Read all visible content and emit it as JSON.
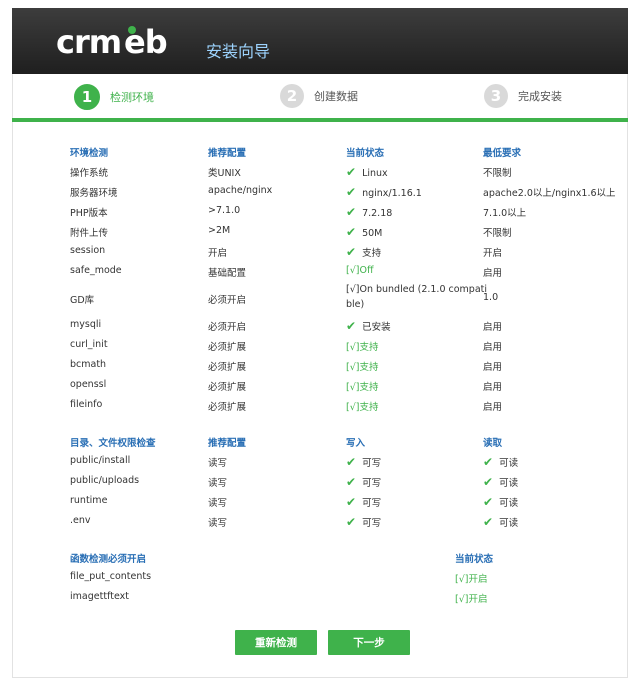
{
  "header": {
    "logo": "crmeb",
    "title": "安装向导"
  },
  "steps": [
    {
      "num": "1",
      "label": "检测环境"
    },
    {
      "num": "2",
      "label": "创建数据"
    },
    {
      "num": "3",
      "label": "完成安装"
    }
  ],
  "env": {
    "headers": [
      "环境检测",
      "推荐配置",
      "当前状态",
      "最低要求"
    ],
    "rows": [
      {
        "name": "操作系统",
        "rec": "类UNIX",
        "cur": "Linux",
        "min": "不限制"
      },
      {
        "name": "服务器环境",
        "rec": "apache/nginx",
        "cur": "nginx/1.16.1",
        "min": "apache2.0以上/nginx1.6以上"
      },
      {
        "name": "PHP版本",
        "rec": ">7.1.0",
        "cur": "7.2.18",
        "min": "7.1.0以上"
      },
      {
        "name": "附件上传",
        "rec": ">2M",
        "cur": "50M",
        "min": "不限制"
      },
      {
        "name": "session",
        "rec": "开启",
        "cur": "支持",
        "min": "开启"
      },
      {
        "name": "safe_mode",
        "rec": "基础配置",
        "cur": "[√]Off",
        "min": "启用"
      },
      {
        "name": "GD库",
        "rec": "必须开启",
        "cur_line1": "[√]On bundled (2.1.0 compati",
        "cur_line2": "ble)",
        "min": "1.0"
      },
      {
        "name": "mysqli",
        "rec": "必须开启",
        "cur": "已安装",
        "min": "启用"
      },
      {
        "name": "curl_init",
        "rec": "必须扩展",
        "cur": "[√]支持",
        "min": "启用"
      },
      {
        "name": "bcmath",
        "rec": "必须扩展",
        "cur": "[√]支持",
        "min": "启用"
      },
      {
        "name": "openssl",
        "rec": "必须扩展",
        "cur": "[√]支持",
        "min": "启用"
      },
      {
        "name": "fileinfo",
        "rec": "必须扩展",
        "cur": "[√]支持",
        "min": "启用"
      }
    ]
  },
  "perm": {
    "headers": [
      "目录、文件权限检查",
      "推荐配置",
      "写入",
      "读取"
    ],
    "rows": [
      {
        "name": "public/install",
        "rec": "读写",
        "w": "可写",
        "r": "可读"
      },
      {
        "name": "public/uploads",
        "rec": "读写",
        "w": "可写",
        "r": "可读"
      },
      {
        "name": "runtime",
        "rec": "读写",
        "w": "可写",
        "r": "可读"
      },
      {
        "name": ".env",
        "rec": "读写",
        "w": "可写",
        "r": "可读"
      }
    ]
  },
  "func": {
    "headers": [
      "函数检测必须开启",
      "当前状态"
    ],
    "rows": [
      {
        "name": "file_put_contents",
        "state": "[√]开启"
      },
      {
        "name": "imagettftext",
        "state": "[√]开启"
      }
    ]
  },
  "buttons": {
    "recheck": "重新检测",
    "next": "下一步"
  },
  "colors": {
    "accent": "#3fb24b",
    "header_text": "#2a6fb5"
  }
}
